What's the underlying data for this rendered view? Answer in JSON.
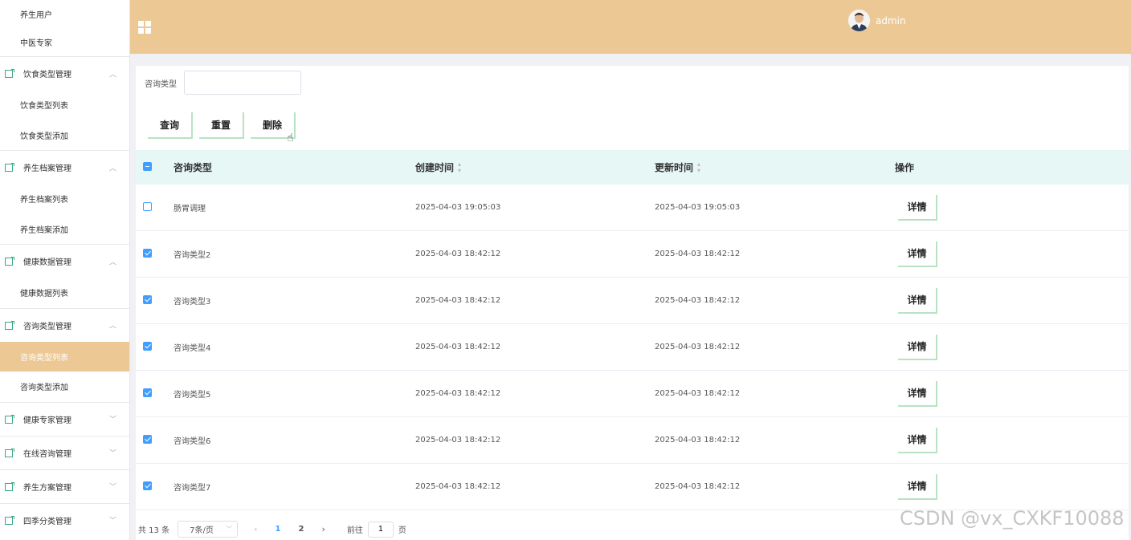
{
  "sidebar": {
    "top_items": [
      "养生用户",
      "中医专家"
    ],
    "groups": [
      {
        "label": "饮食类型管理",
        "chevron": "︿",
        "items": [
          "饮食类型列表",
          "饮食类型添加"
        ]
      },
      {
        "label": "养生档案管理",
        "chevron": "︿",
        "items": [
          "养生档案列表",
          "养生档案添加"
        ]
      },
      {
        "label": "健康数据管理",
        "chevron": "︿",
        "items": [
          "健康数据列表"
        ]
      },
      {
        "label": "咨询类型管理",
        "chevron": "︿",
        "items": [
          "咨询类型列表",
          "咨询类型添加"
        ]
      },
      {
        "label": "健康专家管理",
        "chevron": "﹀",
        "items": []
      },
      {
        "label": "在线咨询管理",
        "chevron": "﹀",
        "items": []
      },
      {
        "label": "养生方案管理",
        "chevron": "﹀",
        "items": []
      },
      {
        "label": "四季分类管理",
        "chevron": "﹀",
        "items": []
      }
    ],
    "active_item": "咨询类型列表"
  },
  "header": {
    "username": "admin",
    "bg_color": "#ecc894"
  },
  "search": {
    "label": "咨询类型",
    "value": ""
  },
  "toolbar": {
    "query_label": "查询",
    "reset_label": "重置",
    "delete_label": "删除"
  },
  "table": {
    "headers": {
      "type": "咨询类型",
      "created": "创建时间",
      "updated": "更新时间",
      "action": "操作"
    },
    "detail_label": "详情",
    "rows": [
      {
        "type": "肠胃调理",
        "created": "2025-04-03 19:05:03",
        "updated": "2025-04-03 19:05:03",
        "checked": false
      },
      {
        "type": "咨询类型2",
        "created": "2025-04-03 18:42:12",
        "updated": "2025-04-03 18:42:12",
        "checked": true
      },
      {
        "type": "咨询类型3",
        "created": "2025-04-03 18:42:12",
        "updated": "2025-04-03 18:42:12",
        "checked": true
      },
      {
        "type": "咨询类型4",
        "created": "2025-04-03 18:42:12",
        "updated": "2025-04-03 18:42:12",
        "checked": true
      },
      {
        "type": "咨询类型5",
        "created": "2025-04-03 18:42:12",
        "updated": "2025-04-03 18:42:12",
        "checked": true
      },
      {
        "type": "咨询类型6",
        "created": "2025-04-03 18:42:12",
        "updated": "2025-04-03 18:42:12",
        "checked": true
      },
      {
        "type": "咨询类型7",
        "created": "2025-04-03 18:42:12",
        "updated": "2025-04-03 18:42:12",
        "checked": true
      }
    ]
  },
  "pagination": {
    "total": "共 13 条",
    "page_size": "7条/页",
    "pages": [
      "1",
      "2"
    ],
    "current_page": "1",
    "jump_label": "前往",
    "jump_value": "1",
    "page_suffix": "页"
  },
  "watermark": "CSDN @vx_CXKF10088"
}
